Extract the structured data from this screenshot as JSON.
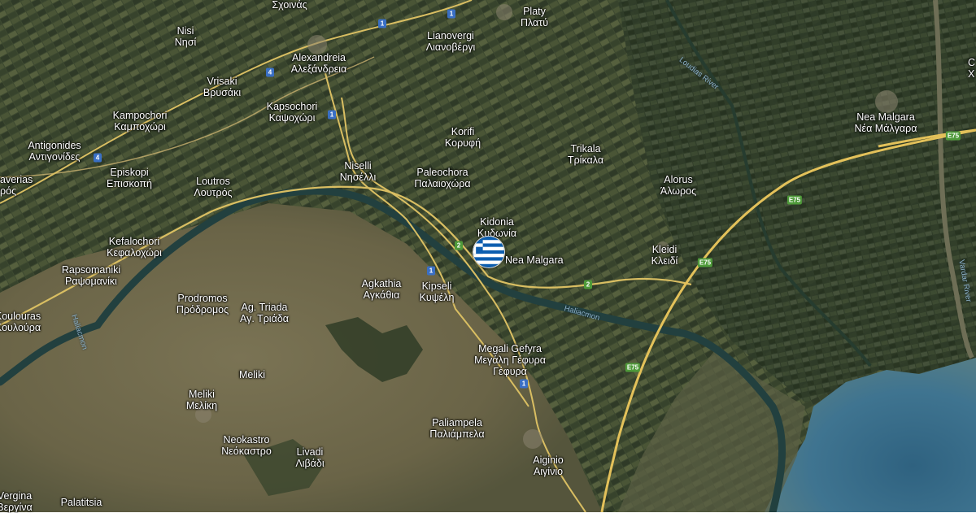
{
  "map": {
    "colors": {
      "plain": "#3f4a33",
      "fields_dark": "#2f3a2a",
      "hills": "#6b6648",
      "sea": "#3d6f8c",
      "river": "#2c4a4c",
      "highway": "#e3c15a",
      "road": "#c9b170"
    },
    "places": [
      {
        "latin": "Σχοινάς",
        "greek": ""
      },
      {
        "latin": "Platy",
        "greek": "Πλατύ"
      },
      {
        "latin": "Nisi",
        "greek": "Νησί"
      },
      {
        "latin": "Lianovergi",
        "greek": "Λιανοβέργι"
      },
      {
        "latin": "Alexandreia",
        "greek": "Αλεξάνδρεια"
      },
      {
        "latin": "Vrisaki",
        "greek": "Βρυσάκι"
      },
      {
        "latin": "Kampochori",
        "greek": "Καμποχώρι"
      },
      {
        "latin": "Kapsochori",
        "greek": "Καψοχώρι"
      },
      {
        "latin": "Antigonides",
        "greek": "Αντιγονίδες"
      },
      {
        "latin": "Korifi",
        "greek": "Κορυφή"
      },
      {
        "latin": "Trikala",
        "greek": "Τρίκαλα"
      },
      {
        "latin": "Episkopi",
        "greek": "Επισκοπή"
      },
      {
        "latin": "Niselli",
        "greek": "Νησέλλι"
      },
      {
        "latin": "Paleochora",
        "greek": "Παλαιοχώρα"
      },
      {
        "latin": "Alorus",
        "greek": "Άλωρος"
      },
      {
        "latin": "Loutros",
        "greek": "Λουτρός"
      },
      {
        "latin": "Kidonia",
        "greek": "Κυδωνία"
      },
      {
        "latin": "Kefalochori",
        "greek": "Κεφαλοχώρι"
      },
      {
        "latin": "Kleidi",
        "greek": "Κλειδί"
      },
      {
        "latin": "Rapsomaniki",
        "greek": "Ραψομανίκι"
      },
      {
        "latin": "Agkathia",
        "greek": "Αγκάθια"
      },
      {
        "latin": "Kipseli",
        "greek": "Κυψέλη"
      },
      {
        "latin": "Prodromos",
        "greek": "Πρόδρομος"
      },
      {
        "latin": "Ag. Triada",
        "greek": "Αγ. Τριάδα"
      },
      {
        "latin": "Megali Gefyra",
        "greek": "Μεγάλη Γέφυρα"
      },
      {
        "latin": "Meliki",
        "greek": ""
      },
      {
        "latin": "Meliki",
        "greek": "Μελίκη"
      },
      {
        "latin": "Paliampela",
        "greek": "Παλιάμπελα"
      },
      {
        "latin": "Neokastro",
        "greek": "Νεόκαστρο"
      },
      {
        "latin": "Livadi",
        "greek": "Λιβάδι"
      },
      {
        "latin": "Aiginio",
        "greek": "Αιγίνιο"
      },
      {
        "latin": "Palatitsia",
        "greek": "Παλατίτσια"
      },
      {
        "latin": "Vergina",
        "greek": "Βεργίνα"
      },
      {
        "latin": "Koulouras",
        "greek": "Κουλούρα"
      },
      {
        "latin": "averias",
        "greek": "ρός"
      },
      {
        "latin": "Nea Malgara",
        "greek": "Νέα Μάλγαρα"
      },
      {
        "latin": "C",
        "greek": "Χ"
      }
    ],
    "marker": {
      "name": "Nea Malgara",
      "flag": "Greece"
    },
    "shields": [
      "1",
      "1",
      "4",
      "4",
      "1",
      "1",
      "1",
      "2",
      "2",
      "E75",
      "E75",
      "E75",
      "E75"
    ],
    "rivers": [
      "Loudias River",
      "Haliacmon",
      "Haliacmon",
      "Vardar River"
    ]
  }
}
